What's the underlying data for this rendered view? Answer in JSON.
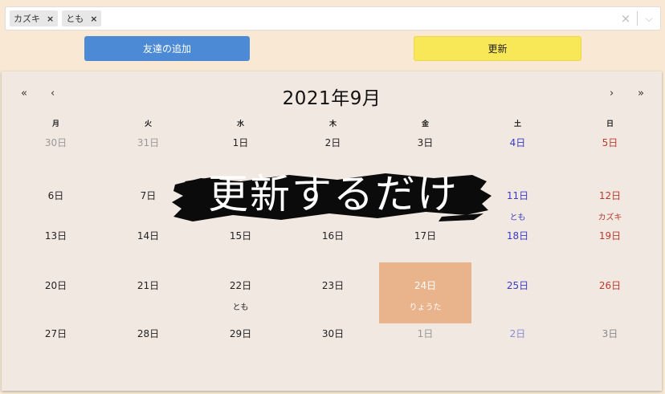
{
  "select": {
    "tags": [
      "カズキ",
      "とも"
    ],
    "remove_glyph": "×",
    "clear_glyph": "×",
    "chevron_glyph": "⌵"
  },
  "buttons": {
    "add_friend": "友達の追加",
    "update": "更新"
  },
  "calendar": {
    "title": "2021年9月",
    "nav": {
      "prev_year": "«",
      "prev_month": "‹",
      "next_month": "›",
      "next_year": "»"
    },
    "weekdays": [
      "月",
      "火",
      "水",
      "木",
      "金",
      "土",
      "日"
    ],
    "weeks": [
      [
        {
          "day": "30日",
          "other": true
        },
        {
          "day": "31日",
          "other": true
        },
        {
          "day": "1日"
        },
        {
          "day": "2日"
        },
        {
          "day": "3日"
        },
        {
          "day": "4日"
        },
        {
          "day": "5日"
        }
      ],
      [
        {
          "day": "6日"
        },
        {
          "day": "7日"
        },
        {
          "day": ""
        },
        {
          "day": ""
        },
        {
          "day": ""
        },
        {
          "day": "11日",
          "event": "とも"
        },
        {
          "day": "12日",
          "event": "カズキ"
        }
      ],
      [
        {
          "day": "13日"
        },
        {
          "day": "14日"
        },
        {
          "day": "15日"
        },
        {
          "day": "16日"
        },
        {
          "day": "17日"
        },
        {
          "day": "18日"
        },
        {
          "day": "19日"
        }
      ],
      [
        {
          "day": "20日"
        },
        {
          "day": "21日"
        },
        {
          "day": "22日",
          "event": "とも"
        },
        {
          "day": "23日"
        },
        {
          "day": "24日",
          "event": "りょうた",
          "today": true
        },
        {
          "day": "25日"
        },
        {
          "day": "26日"
        }
      ],
      [
        {
          "day": "27日"
        },
        {
          "day": "28日"
        },
        {
          "day": "29日"
        },
        {
          "day": "30日"
        },
        {
          "day": "1日",
          "other": true
        },
        {
          "day": "2日",
          "other": true
        },
        {
          "day": "3日",
          "other": true
        }
      ]
    ]
  },
  "overlay": {
    "text": "更新するだけ"
  },
  "colors": {
    "add_button": "#4c8ad6",
    "update_button": "#f8e858",
    "today": "#e9b38c",
    "saturday": "#3a3ac8",
    "sunday": "#b83a2e"
  }
}
